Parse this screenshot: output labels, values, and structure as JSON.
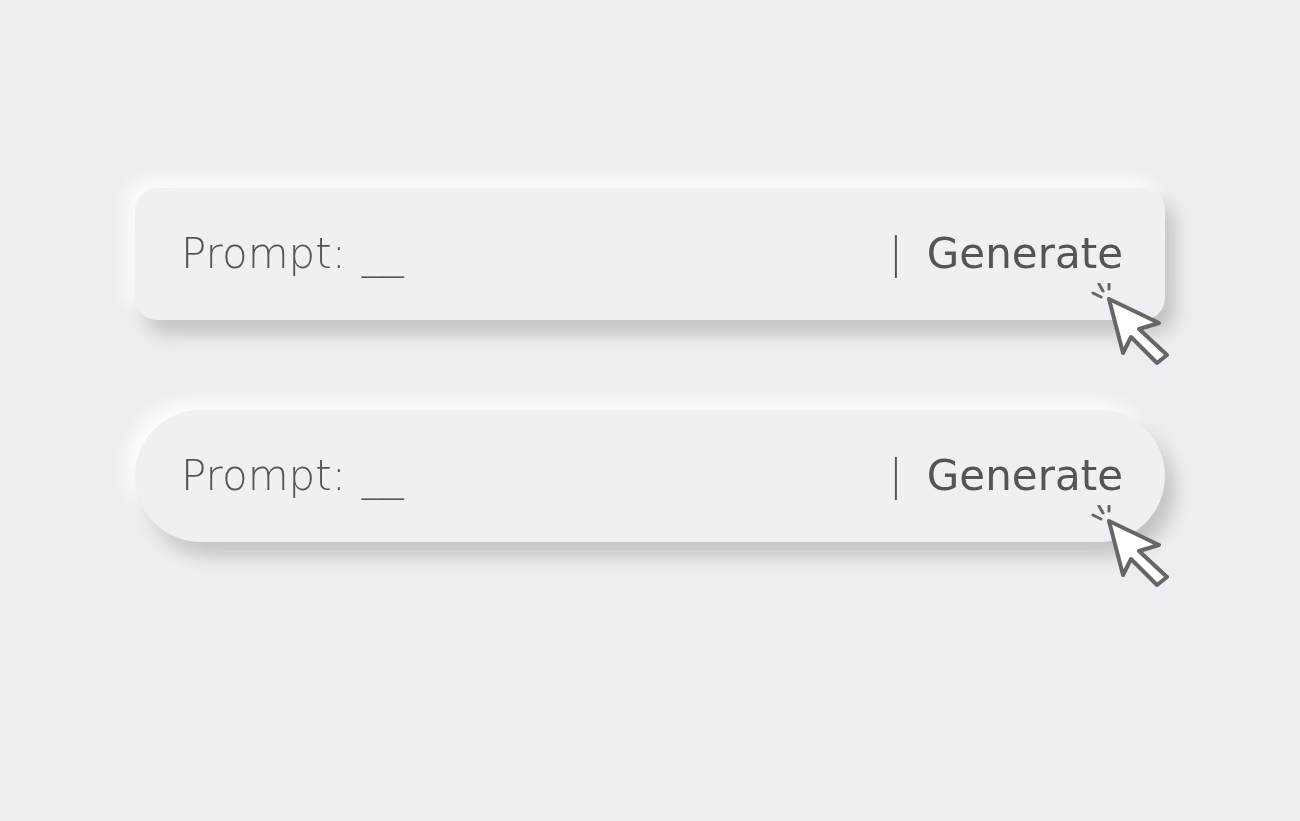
{
  "prompt_bars": [
    {
      "kind": "rounded",
      "label": "Prompt:",
      "blank": "__",
      "divider": "|",
      "button": "Generate"
    },
    {
      "kind": "pill",
      "label": "Prompt:",
      "blank": "__",
      "divider": "|",
      "button": "Generate"
    }
  ]
}
